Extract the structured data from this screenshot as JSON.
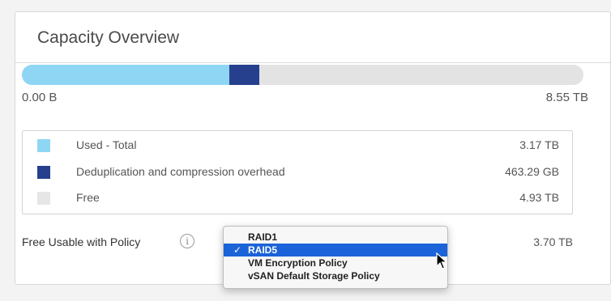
{
  "card": {
    "title": "Capacity Overview"
  },
  "capacity_bar": {
    "min_label": "0.00 B",
    "max_label": "8.55 TB",
    "used_fraction": 0.371,
    "dedup_fraction": 0.053,
    "colors": {
      "used": "#8fd6f5",
      "dedup": "#26408e",
      "free": "#e3e3e3"
    }
  },
  "legend": [
    {
      "label": "Used - Total",
      "value": "3.17 TB",
      "color": "#8fd6f5"
    },
    {
      "label": "Deduplication and compression overhead",
      "value": "463.29 GB",
      "color": "#26408e"
    },
    {
      "label": "Free",
      "value": "4.93 TB",
      "color": "#e6e6e6"
    }
  ],
  "policy": {
    "label": "Free Usable with Policy",
    "info_icon": "info-icon",
    "info_glyph": "i",
    "value": "3.70 TB"
  },
  "policy_dropdown": {
    "check_glyph": "✓",
    "selected_index": 1,
    "options": [
      "RAID1",
      "RAID5",
      "VM Encryption Policy",
      "vSAN Default Storage Policy"
    ]
  }
}
